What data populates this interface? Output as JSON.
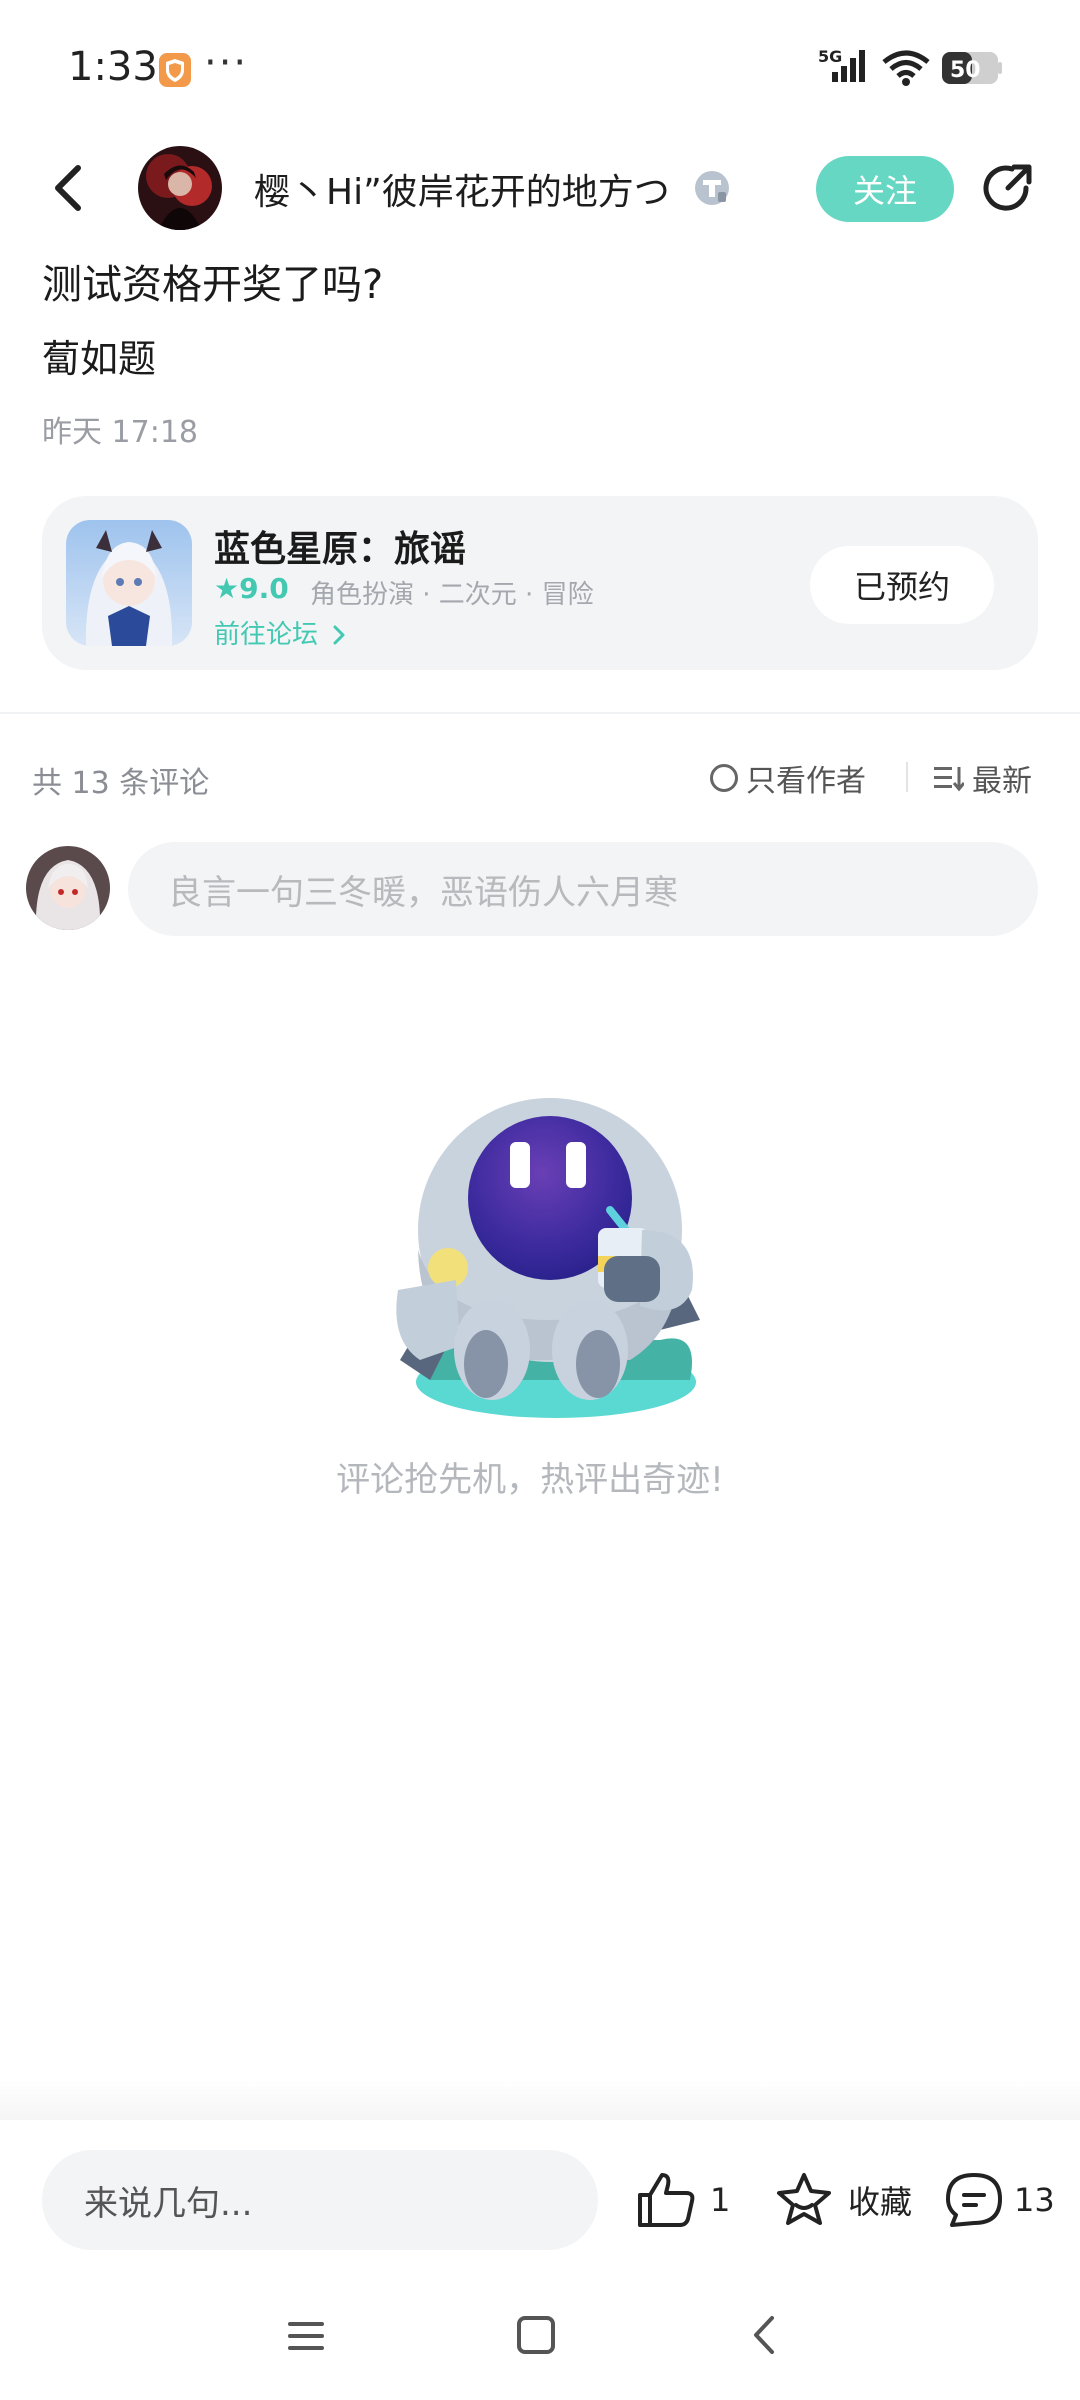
{
  "status_bar": {
    "time": "1:33",
    "dots": "···",
    "network": "5G",
    "battery": "50"
  },
  "header": {
    "author_name": "樱丶Hi”彼岸花开的地方つ",
    "follow_label": "关注"
  },
  "post": {
    "title": "测试资格开奖了吗?",
    "body": "蔔如题",
    "time": "昨天 17:18"
  },
  "game_card": {
    "name": "蓝色星原：旅谣",
    "rating": "9.0",
    "tags": "角色扮演 · 二次元 · 冒险",
    "forum_link": "前往论坛",
    "reserved_label": "已预约"
  },
  "comments": {
    "count_label": "共 13 条评论",
    "author_only_label": "只看作者",
    "sort_label": "最新",
    "input_placeholder": "良言一句三冬暖，恶语伤人六月寒",
    "empty_text": "评论抢先机，热评出奇迹!"
  },
  "bottom_bar": {
    "input_placeholder": "来说几句...",
    "like_count": "1",
    "favorite_label": "收藏",
    "comment_count": "13"
  },
  "colors": {
    "accent": "#66d7c3",
    "accent_text": "#43c9b2",
    "card_bg": "#f3f4f6"
  }
}
